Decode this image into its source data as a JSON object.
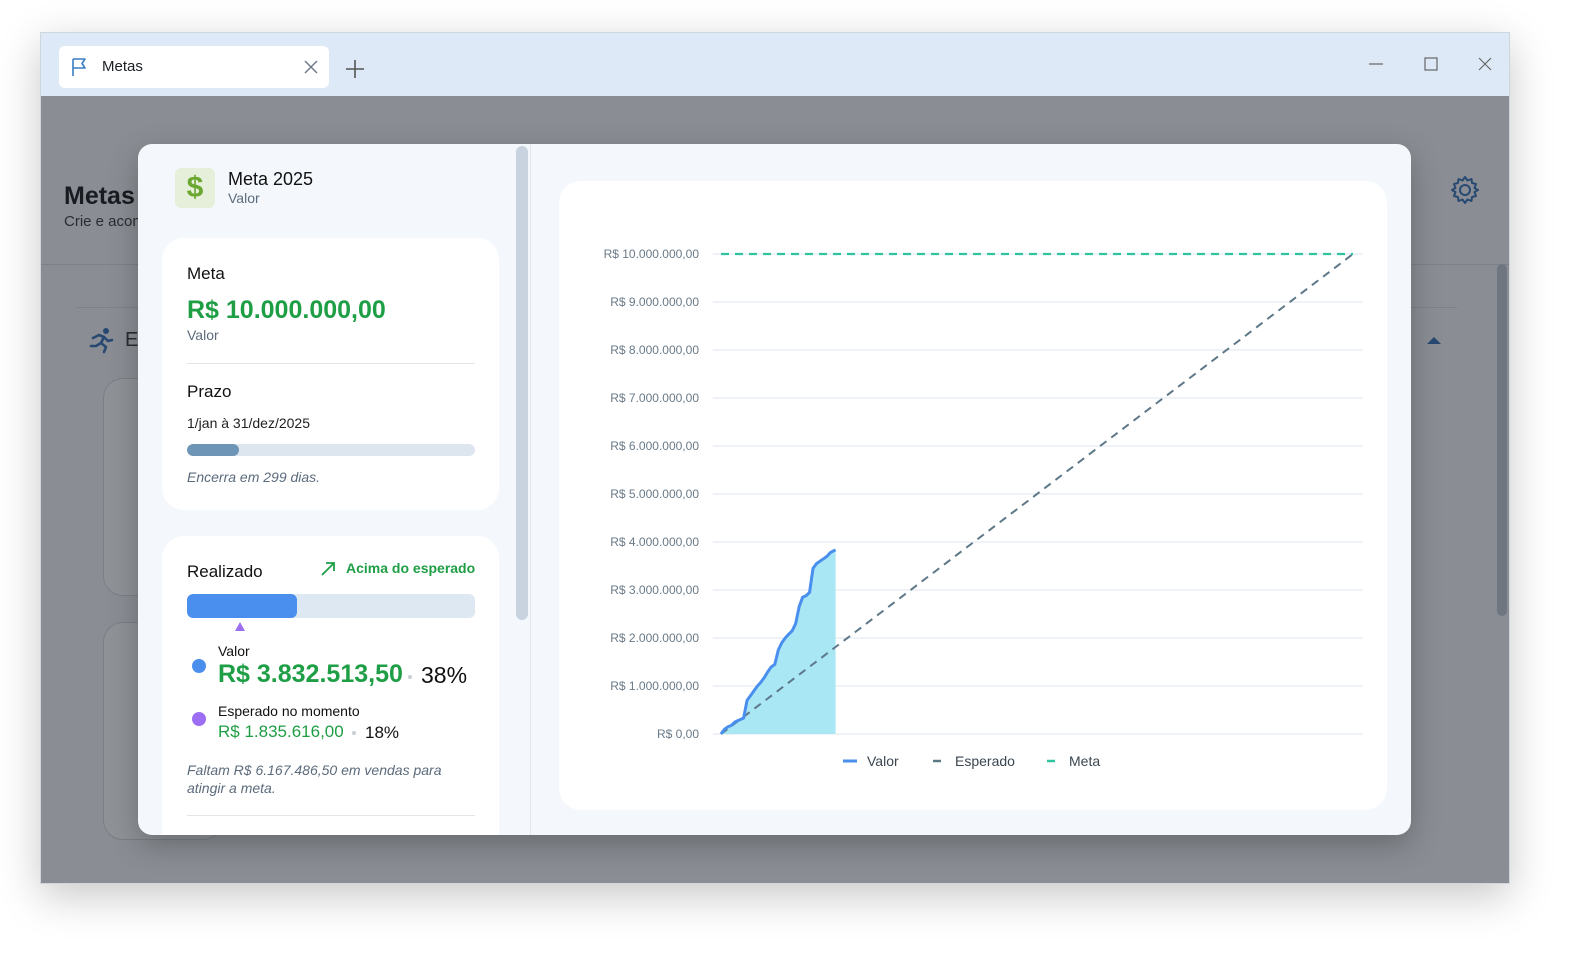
{
  "tab": {
    "title": "Metas",
    "icon": "flag-icon"
  },
  "background": {
    "title": "Metas",
    "subtitle": "Crie e acom",
    "section_label": "E"
  },
  "goal": {
    "title": "Meta 2025",
    "subtitle": "Valor",
    "icon_glyph": "$"
  },
  "meta_card": {
    "label": "Meta",
    "value": "R$ 10.000.000,00",
    "value_type": "Valor",
    "prazo_label": "Prazo",
    "prazo_dates": "1/jan à 31/dez/2025",
    "prazo_progress": 0.18,
    "prazo_note": "Encerra em 299 dias."
  },
  "realizado_card": {
    "label": "Realizado",
    "status": "Acima do esperado",
    "valor_label": "Valor",
    "valor": "R$ 3.832.513,50",
    "valor_pct": "38%",
    "valor_fraction": 0.3832,
    "esperado_label": "Esperado no momento",
    "esperado": "R$ 1.835.616,00",
    "esperado_pct": "18%",
    "esperado_fraction": 0.1836,
    "faltam_note": "Faltam R$ 6.167.486,50 em vendas para atingir a meta."
  },
  "colors": {
    "valor": "#4a8fee",
    "esperado": "#9b6ef3",
    "meta_line": "#2ec4a0",
    "esperado_line": "#5e7889",
    "area": "#a9e7f5",
    "green": "#1e9e45"
  },
  "chart_data": {
    "type": "line",
    "y_ticks": [
      "R$ 0,00",
      "R$ 1.000.000,00",
      "R$ 2.000.000,00",
      "R$ 3.000.000,00",
      "R$ 4.000.000,00",
      "R$ 5.000.000,00",
      "R$ 6.000.000,00",
      "R$ 7.000.000,00",
      "R$ 8.000.000,00",
      "R$ 9.000.000,00",
      "R$ 10.000.000,00"
    ],
    "ylim": [
      0,
      10000000
    ],
    "xlim": [
      1,
      365
    ],
    "grid": true,
    "legend_position": "bottom",
    "legend": [
      "Valor",
      "Esperado",
      "Meta"
    ],
    "series": [
      {
        "name": "Valor",
        "style": "solid-area",
        "x": [
          1,
          3,
          5,
          7,
          9,
          12,
          14,
          16,
          18,
          20,
          22,
          24,
          26,
          28,
          30,
          32,
          34,
          36,
          38,
          40,
          42,
          44,
          46,
          48,
          50,
          52,
          54,
          56,
          58,
          60,
          62,
          64,
          66,
          67
        ],
        "y": [
          0,
          100000,
          150000,
          180000,
          250000,
          300000,
          330000,
          700000,
          800000,
          900000,
          1000000,
          1080000,
          1180000,
          1300000,
          1400000,
          1450000,
          1750000,
          1900000,
          2000000,
          2080000,
          2150000,
          2300000,
          2650000,
          2850000,
          2880000,
          2950000,
          3450000,
          3550000,
          3600000,
          3650000,
          3700000,
          3780000,
          3820000,
          3832513
        ]
      },
      {
        "name": "Esperado",
        "style": "dashed",
        "x": [
          1,
          365
        ],
        "y": [
          0,
          10000000
        ]
      },
      {
        "name": "Meta",
        "style": "dashed",
        "x": [
          1,
          365
        ],
        "y": [
          10000000,
          10000000
        ]
      }
    ]
  }
}
